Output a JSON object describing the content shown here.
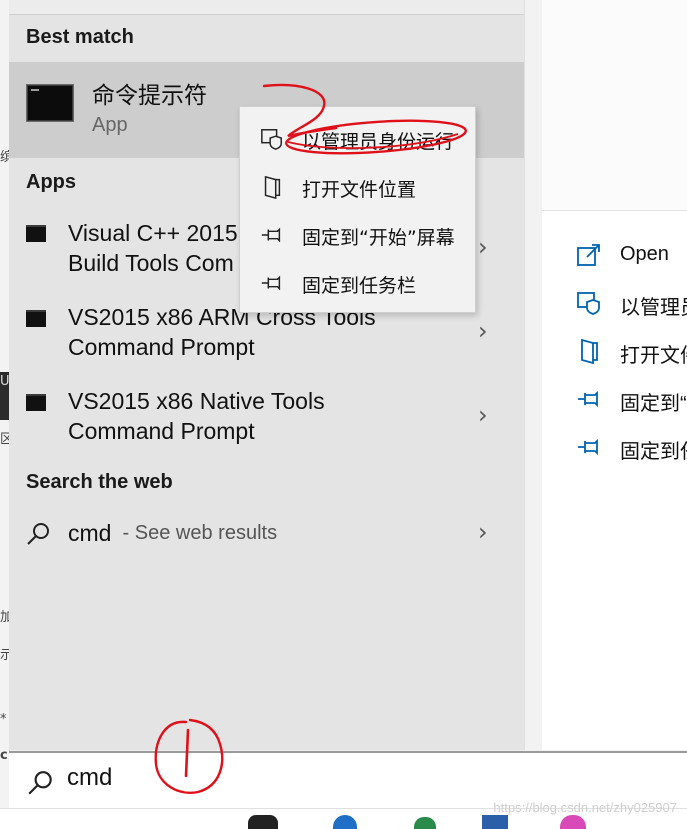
{
  "background_glyphs": [
    "缤",
    "U",
    "区",
    "加",
    "示",
    "*",
    "c"
  ],
  "best_match": {
    "heading": "Best match",
    "app_name": "命令提示符",
    "app_type": "App"
  },
  "context_menu": {
    "items": [
      {
        "label": "以管理员身份运行",
        "icon": "shield-icon"
      },
      {
        "label": "打开文件位置",
        "icon": "file-location-icon"
      },
      {
        "label": "固定到“开始”屏幕",
        "icon": "pin-icon"
      },
      {
        "label": "固定到任务栏",
        "icon": "pin-icon"
      }
    ]
  },
  "apps": {
    "heading": "Apps",
    "items": [
      {
        "line1": "Visual C++ 2015",
        "line2": "Build Tools Com"
      },
      {
        "line1": "VS2015 x86 ARM Cross Tools",
        "line2": "Command Prompt"
      },
      {
        "line1": "VS2015 x86 Native Tools",
        "line2": "Command Prompt"
      }
    ]
  },
  "search_web": {
    "heading": "Search the web",
    "query": "cmd",
    "suffix": " - See web results"
  },
  "right_panel": {
    "actions": [
      {
        "label": "Open",
        "icon": "open-icon"
      },
      {
        "label": "以管理员",
        "icon": "shield-icon"
      },
      {
        "label": "打开文件",
        "icon": "file-location-icon"
      },
      {
        "label": "固定到“",
        "icon": "pin-icon"
      },
      {
        "label": "固定到任",
        "icon": "pin-icon"
      }
    ]
  },
  "search_box": {
    "value": "cmd"
  },
  "annotations": {
    "step1": "①",
    "step2": "2"
  },
  "watermark": "https://blog.csdn.net/zhy025907",
  "colors": {
    "accent_blue": "#0063b1",
    "annotation_red": "#e0101a",
    "best_match_highlight": "#cdcdcd",
    "panel_bg": "#e4e4e4"
  }
}
